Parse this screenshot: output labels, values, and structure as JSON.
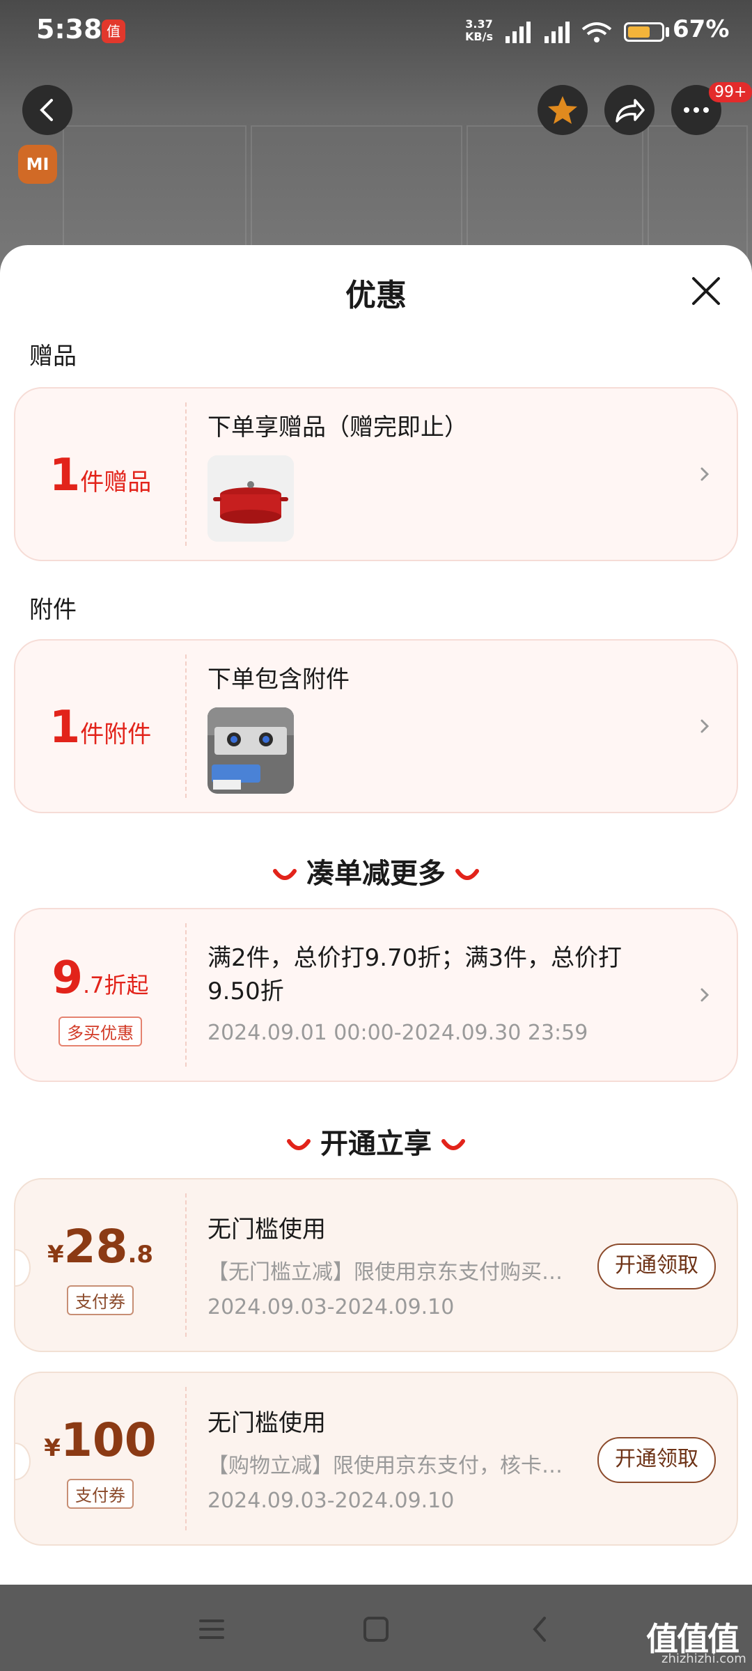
{
  "status": {
    "time": "5:38",
    "app_icon": "值",
    "net_speed_top": "3.37",
    "net_speed_bottom": "KB/s",
    "battery_text": "67%",
    "battery_level": 0.67,
    "battery_color": "#f3b43a"
  },
  "topbar": {
    "badge": "99+",
    "brand": "MI"
  },
  "sheet": {
    "title": "优惠",
    "gifts_section": "赠品",
    "gift_card": {
      "count": "1",
      "unit": "件赠品",
      "title": "下单享赠品（赠完即止）"
    },
    "accessory_section": "附件",
    "accessory_card": {
      "count": "1",
      "unit": "件附件",
      "title": "下单包含附件"
    },
    "more_heading": "凑单减更多",
    "promo_card": {
      "big": "9",
      "small": ".7折起",
      "tag": "多买优惠",
      "text": "满2件，总价打9.70折；满3件，总价打9.50折",
      "date": "2024.09.01 00:00-2024.09.30 23:59"
    },
    "open_heading": "开通立享",
    "coupons": [
      {
        "currency": "¥",
        "amount": "28",
        "decimal": ".8",
        "tag": "支付券",
        "title": "无门槛使用",
        "desc": "【无门槛立减】限使用京东支付购买…",
        "date": "2024.09.03-2024.09.10",
        "button": "开通领取"
      },
      {
        "currency": "¥",
        "amount": "100",
        "decimal": "",
        "tag": "支付券",
        "title": "无门槛使用",
        "desc": "【购物立减】限使用京东支付，核卡…",
        "date": "2024.09.03-2024.09.10",
        "button": "开通领取"
      }
    ]
  },
  "watermark": {
    "main": "值值值",
    "sub": "zhizhizhi.com"
  },
  "colors": {
    "accent_red": "#e2231a",
    "coupon_brown": "#8b3a14"
  }
}
